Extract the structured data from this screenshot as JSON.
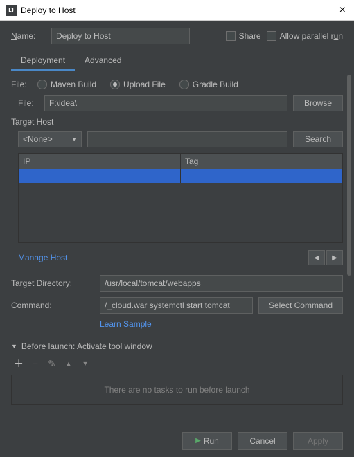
{
  "window": {
    "title": "Deploy to Host"
  },
  "header": {
    "name_label": "Name:",
    "name_value": "Deploy to Host",
    "share_label": "Share",
    "allow_parallel_label": "Allow parallel run"
  },
  "tabs": {
    "deployment": "Deployment",
    "advanced": "Advanced"
  },
  "deployment": {
    "file_source_label": "File:",
    "radios": {
      "maven": "Maven Build",
      "upload": "Upload File",
      "gradle": "Gradle Build"
    },
    "file_label": "File:",
    "file_value": "F:\\idea\\",
    "browse_label": "Browse",
    "target_host_label": "Target Host",
    "host_dropdown": "<None>",
    "search_label": "Search",
    "columns": {
      "ip": "IP",
      "tag": "Tag"
    },
    "manage_host": "Manage Host",
    "target_dir_label": "Target Directory:",
    "target_dir_value": "/usr/local/tomcat/webapps",
    "command_label": "Command:",
    "command_value": "/_cloud.war systemctl start tomcat",
    "select_command_label": "Select Command",
    "learn_sample": "Learn Sample"
  },
  "before_launch": {
    "title": "Before launch: Activate tool window",
    "empty": "There are no tasks to run before launch"
  },
  "footer": {
    "run": "Run",
    "cancel": "Cancel",
    "apply": "Apply"
  }
}
